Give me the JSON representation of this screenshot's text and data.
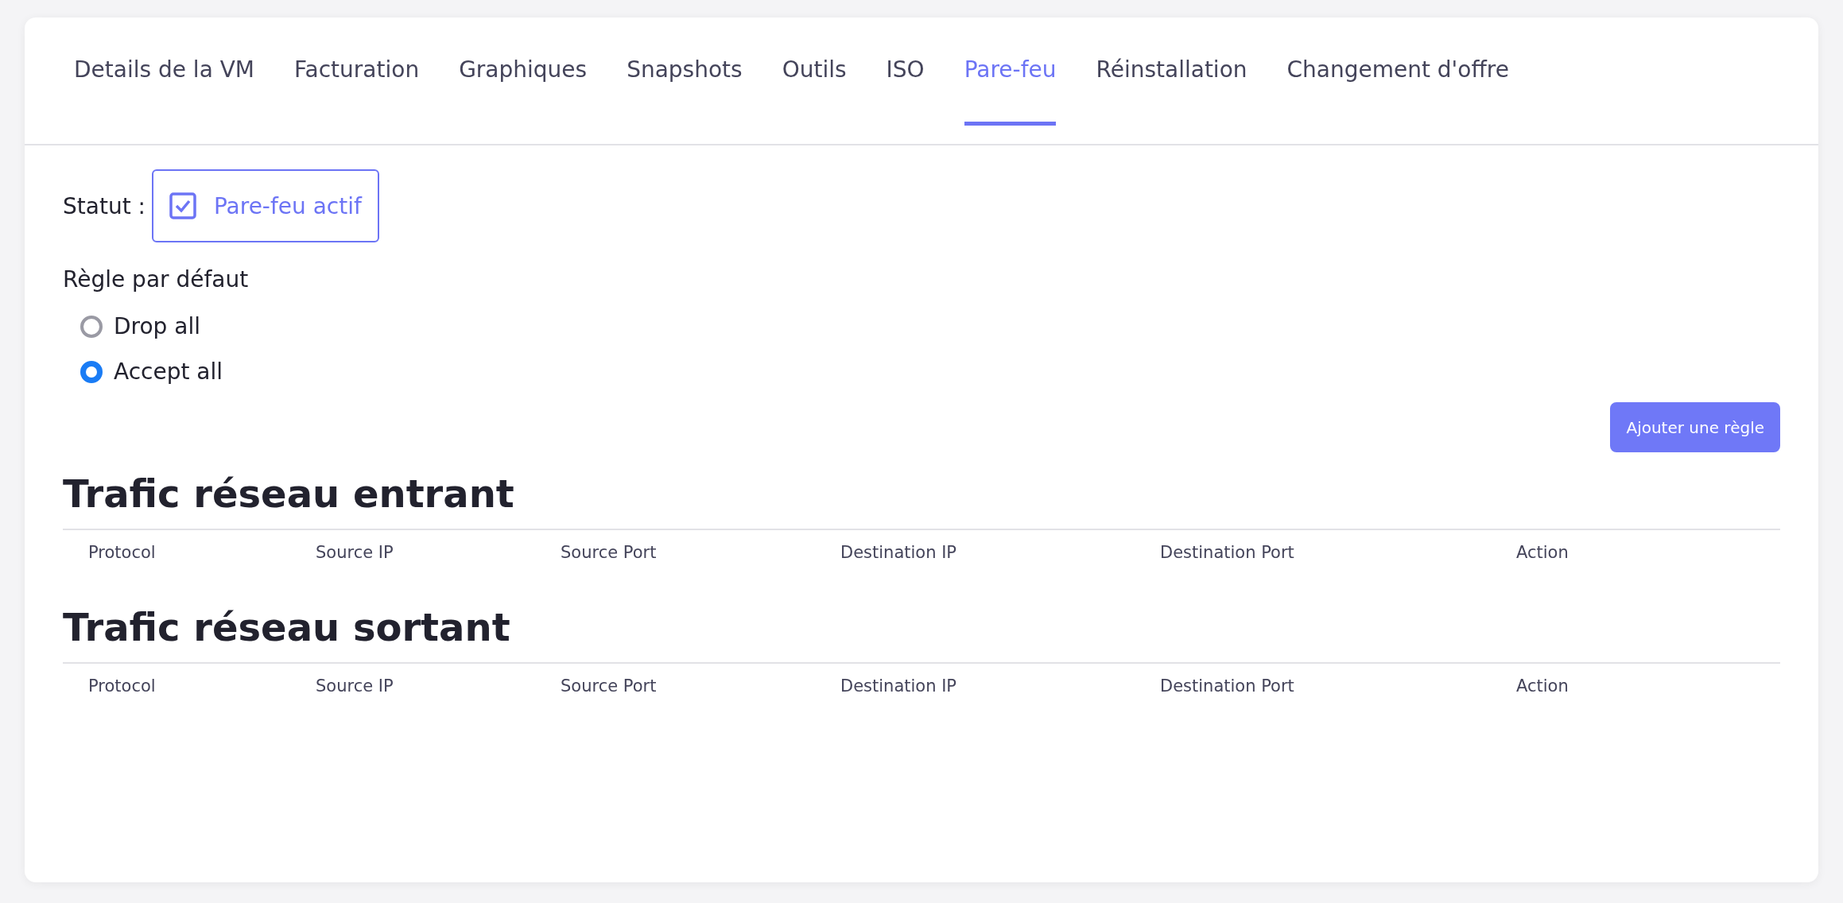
{
  "tabs": [
    {
      "label": "Details de la VM",
      "selected": false
    },
    {
      "label": "Facturation",
      "selected": false
    },
    {
      "label": "Graphiques",
      "selected": false
    },
    {
      "label": "Snapshots",
      "selected": false
    },
    {
      "label": "Outils",
      "selected": false
    },
    {
      "label": "ISO",
      "selected": false
    },
    {
      "label": "Pare-feu",
      "selected": true
    },
    {
      "label": "Réinstallation",
      "selected": false
    },
    {
      "label": "Changement d'offre",
      "selected": false
    }
  ],
  "status": {
    "label": "Statut :",
    "toggle": {
      "label": "Pare-feu actif",
      "checked": true
    }
  },
  "default_rule": {
    "title": "Règle par défaut",
    "options": [
      {
        "label": "Drop all",
        "selected": false
      },
      {
        "label": "Accept all",
        "selected": true
      }
    ]
  },
  "add_rule_button": "Ajouter une règle",
  "sections": [
    {
      "title": "Trafic réseau entrant",
      "columns": [
        "Protocol",
        "Source IP",
        "Source Port",
        "Destination IP",
        "Destination Port",
        "Action"
      ]
    },
    {
      "title": "Trafic réseau sortant",
      "columns": [
        "Protocol",
        "Source IP",
        "Source Port",
        "Destination IP",
        "Destination Port",
        "Action"
      ]
    }
  ]
}
